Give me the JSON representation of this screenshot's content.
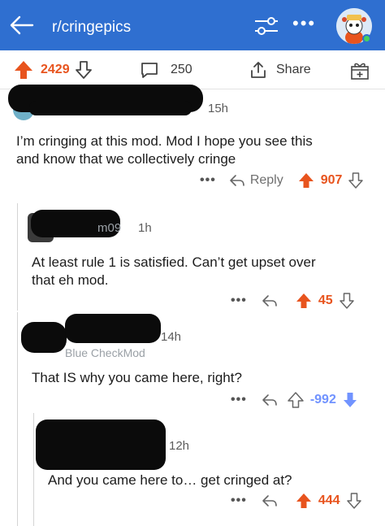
{
  "topbar": {
    "subreddit": "r/cringepics",
    "back_icon": "arrow-left-icon",
    "filter_icon": "sliders-icon",
    "more_label": "•••"
  },
  "post_actions": {
    "score": "2429",
    "comments": "250",
    "share_label": "Share"
  },
  "comments": [
    {
      "time": "15h",
      "text_line1": "I’m cringing at this mod. Mod I hope you see this",
      "text_line2": "and know that we collectively cringe",
      "reply_label": "Reply",
      "score": "907",
      "upvoted": true
    },
    {
      "author_fragment": "m09",
      "time": "1h",
      "text_line1": "At least rule 1 is satisfied. Can’t get upset over",
      "text_line2": "that eh mod.",
      "score": "45",
      "upvoted": true
    },
    {
      "time": "14h",
      "flair": "Blue CheckMod",
      "text_line1": "That IS why you came here, right?",
      "score": "-992",
      "downvoted": true
    },
    {
      "time": "12h",
      "text_line1": "And you came here to… get cringed at?",
      "score": "444",
      "upvoted": true
    }
  ],
  "colors": {
    "header_bg": "#2f6fd0",
    "upvote": "#e8541e",
    "downvote": "#7193ff"
  }
}
